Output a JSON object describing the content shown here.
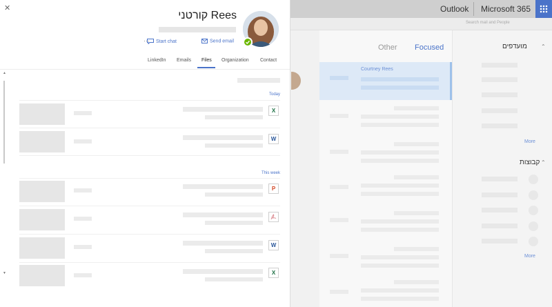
{
  "topbar": {
    "outlook": "Outlook",
    "ms365": "Microsoft 365"
  },
  "search": {
    "placeholder": "Search mail and People"
  },
  "right_pane": {
    "favorites_header": "מועדפים",
    "groups_header": "קבוצות",
    "more_1": "More",
    "more_2": "More"
  },
  "message_list": {
    "tab_focused": "Focused",
    "tab_other": "Other",
    "selected_sender": "Courtney Rees"
  },
  "contact_card": {
    "name": "קורטני Rees",
    "actions": {
      "send_email": "Send email",
      "start_chat": "Start chat",
      "more": "···"
    },
    "tabs": [
      "Contact",
      "Organization",
      "Files",
      "Emails",
      "LinkedIn"
    ],
    "active_tab": "Files",
    "sections": [
      {
        "label": "Today",
        "files": [
          {
            "type": "X"
          },
          {
            "type": "W"
          }
        ]
      },
      {
        "label": "This week",
        "files": [
          {
            "type": "P"
          },
          {
            "type": "PDF"
          },
          {
            "type": "W"
          },
          {
            "type": "X"
          }
        ]
      }
    ]
  },
  "colors": {
    "accent": "#4a73c9",
    "presence": "#6bb700",
    "waffle": "#4a73c9"
  }
}
